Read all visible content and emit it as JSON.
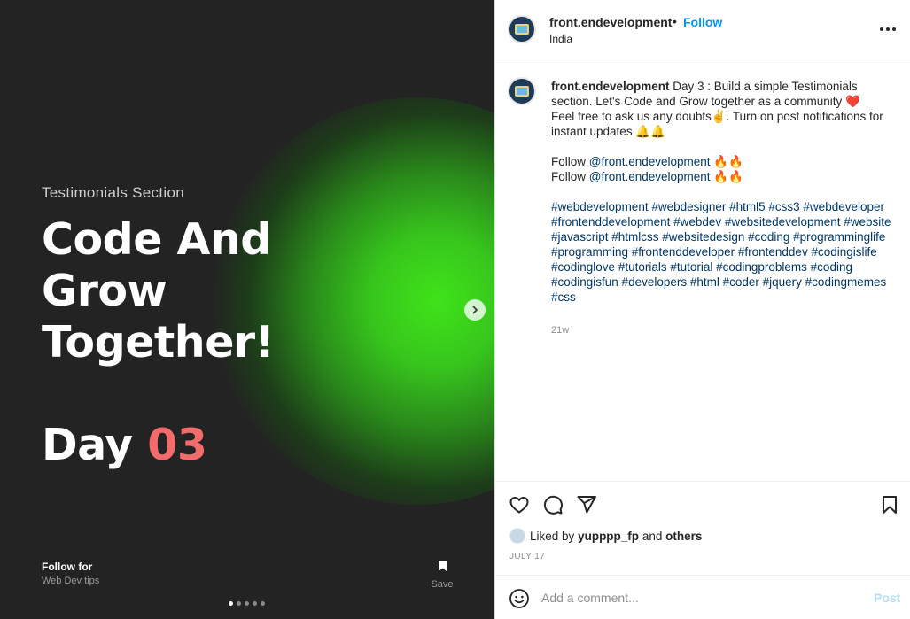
{
  "slide": {
    "subtitle": "Testimonials Section",
    "title_line1": "Code And",
    "title_line2": "Grow",
    "title_line3": "Together!",
    "day_label": "Day",
    "day_number": "03",
    "follow_line1": "Follow for",
    "follow_line2": "Web Dev tips",
    "save_label": "Save",
    "carousel_count": 5,
    "carousel_active": 1
  },
  "header": {
    "username": "front.endevelopment",
    "separator": "•",
    "follow_label": "Follow",
    "location": "India"
  },
  "caption": {
    "username": "front.endevelopment",
    "line1": " Day 3 : Build a simple Testimonials section. Let's Code and Grow together as a community ❤️",
    "line2": "Feel free to ask us any doubts✌️. Turn on post notifications for instant updates 🔔🔔",
    "follow1_prefix": "Follow ",
    "follow1_mention": "@front.endevelopment",
    "follow1_suffix": " 🔥🔥",
    "follow2_prefix": "Follow ",
    "follow2_mention": "@front.endevelopment",
    "follow2_suffix": " 🔥🔥",
    "hashtags": "#webdevelopment #webdesigner #html5 #css3 #webdeveloper #frontenddevelopment #webdev #websitedevelopment #website #javascript #htmlcss #websitedesign #coding #programminglife #programming #frontenddeveloper #frontenddev #codingislife #codinglove #tutorials #tutorial #codingproblems #coding #codingisfun #developers #html #coder #jquery #codingmemes #css",
    "age": "21w"
  },
  "actions": {
    "liked_prefix": "Liked by ",
    "liked_user": "yupppp_fp",
    "liked_and": " and ",
    "liked_others": "others",
    "date": "JULY 17"
  },
  "comment": {
    "placeholder": "Add a comment...",
    "post_label": "Post"
  },
  "colors": {
    "accent_blue": "#0095f6",
    "day_number": "#f46b6b",
    "glow_green": "#3fe31a",
    "hashtag_link": "#00376b"
  }
}
